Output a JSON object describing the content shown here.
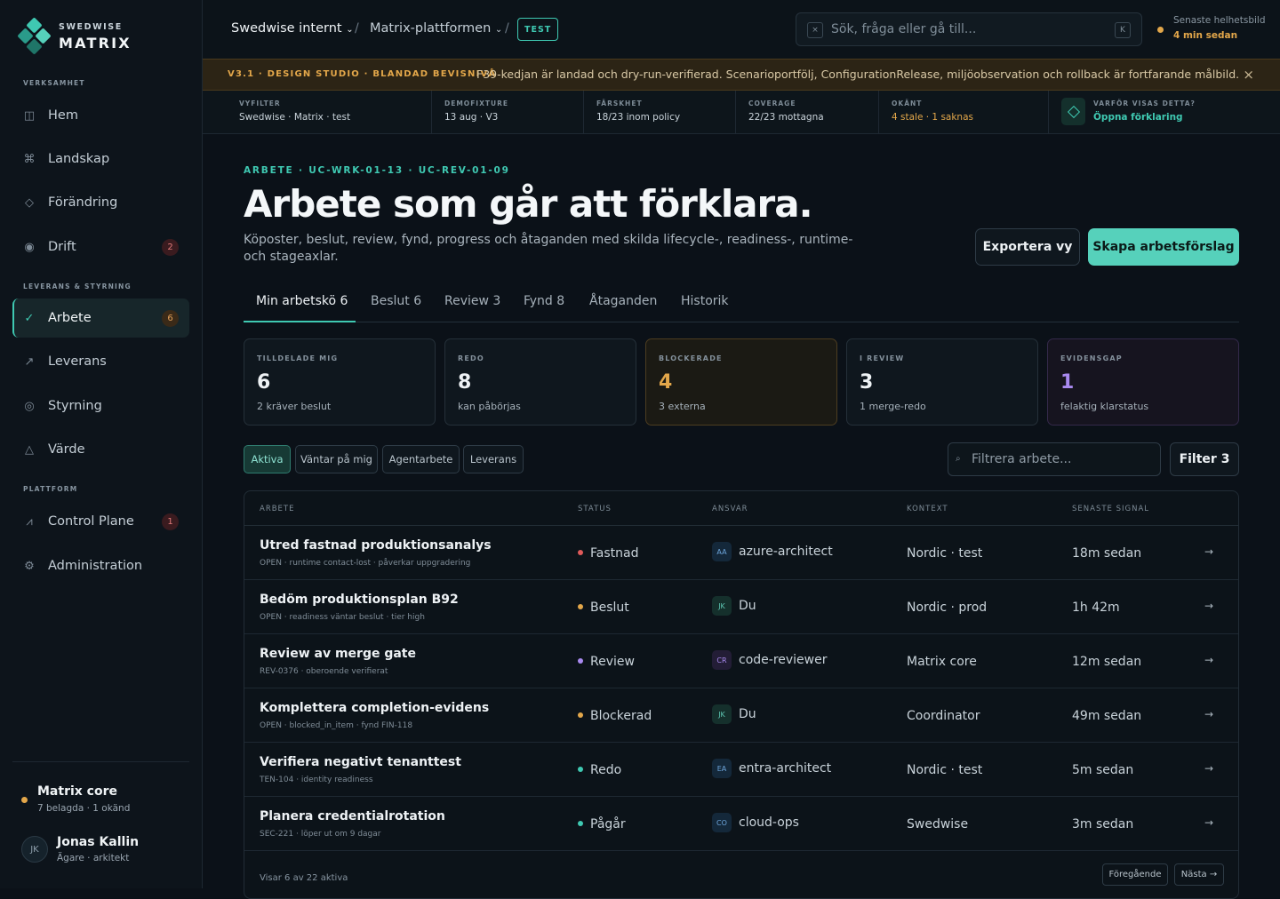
{
  "brand": {
    "top": "SWEDWISE",
    "main": "MATRIX",
    "colors": [
      "#3fc9b2",
      "#2a9b8a",
      "#56d1bb",
      "#1f7568"
    ]
  },
  "sidebar": {
    "sections": [
      "VERKSAMHET",
      "LEVERANS & STYRNING",
      "PLATTFORM"
    ],
    "items": [
      {
        "label": "Hem",
        "icon": "book-icon",
        "glyph": "◫"
      },
      {
        "label": "Landskap",
        "icon": "command-icon",
        "glyph": "⌘"
      },
      {
        "label": "Förändring",
        "icon": "diamond-icon",
        "glyph": "◇"
      },
      {
        "label": "Drift",
        "icon": "radio-icon",
        "glyph": "◉",
        "badge": "2"
      },
      {
        "label": "Arbete",
        "icon": "check-icon",
        "glyph": "✓",
        "badge": "6"
      },
      {
        "label": "Leverans",
        "icon": "arrow-up-right-icon",
        "glyph": "↗"
      },
      {
        "label": "Styrning",
        "icon": "circle-icon",
        "glyph": "◎"
      },
      {
        "label": "Värde",
        "icon": "triangle-icon",
        "glyph": "△"
      },
      {
        "label": "Control Plane",
        "icon": "activity-icon",
        "glyph": "⩘",
        "badge": "1"
      },
      {
        "label": "Administration",
        "icon": "gear-icon",
        "glyph": "⚙"
      }
    ],
    "workspace": {
      "name": "Matrix core",
      "sub": "7 belagda · 1 okänd"
    },
    "user": {
      "initials": "JK",
      "name": "Jonas Kallin",
      "role": "Ägare · arkitekt"
    }
  },
  "topbar": {
    "crumbs": [
      "Swedwise internt",
      "Matrix-plattformen"
    ],
    "env": "TEST",
    "search_placeholder": "Sök, fråga eller gå till...",
    "search_icon": "×",
    "search_kbd": "K",
    "latest_label": "Senaste helhetsbild",
    "latest_value": "4 min sedan"
  },
  "banner": {
    "tag": "V3.1 · DESIGN STUDIO · BLANDAD BEVISNIVÅ",
    "message": "F39-kedjan är landad och dry-run-verifierad. Scenarioportfölj, ConfigurationRelease, miljöobservation och rollback är fortfarande målbild.",
    "close": "×"
  },
  "meta": [
    {
      "key": "VYFILTER",
      "value": "Swedwise · Matrix · test"
    },
    {
      "key": "DEMOFIXTURE",
      "value": "13 aug · V3"
    },
    {
      "key": "FÄRSKHET",
      "value": "18/23 inom policy"
    },
    {
      "key": "COVERAGE",
      "value": "22/23 mottagna"
    },
    {
      "key": "OKÄNT",
      "value": "4 stale · 1 saknas"
    },
    {
      "key": "VARFÖR VISAS DETTA?",
      "value": "Öppna förklaring"
    }
  ],
  "page": {
    "eyebrow": "ARBETE · UC-WRK-01-13 · UC-REV-01-09",
    "title": "Arbete som går att förklara.",
    "description": "Köposter, beslut, review, fynd, progress och åtaganden med skilda lifecycle-, readiness-, runtime- och stageaxlar.",
    "export_label": "Exportera vy",
    "create_label": "Skapa arbetsförslag"
  },
  "tabs": [
    "Min arbetskö 6",
    "Beslut 6",
    "Review 3",
    "Fynd 8",
    "Åtaganden",
    "Historik"
  ],
  "cards": [
    {
      "key": "TILLDELADE MIG",
      "value": "6",
      "sub": "2 kräver beslut"
    },
    {
      "key": "REDO",
      "value": "8",
      "sub": "kan påbörjas"
    },
    {
      "key": "BLOCKERADE",
      "value": "4",
      "sub": "3 externa"
    },
    {
      "key": "I REVIEW",
      "value": "3",
      "sub": "1 merge-redo"
    },
    {
      "key": "EVIDENSGAP",
      "value": "1",
      "sub": "felaktig klarstatus"
    }
  ],
  "chips": [
    "Aktiva",
    "Väntar på mig",
    "Agentarbete",
    "Leverans"
  ],
  "filter": {
    "placeholder": "Filtrera arbete...",
    "icon": "⌕",
    "button": "Filter 3"
  },
  "table": {
    "headers": [
      "ARBETE",
      "STATUS",
      "ANSVAR",
      "KONTEXT",
      "SENASTE SIGNAL"
    ],
    "rows": [
      {
        "title": "Utred fastnad produktionsanalys",
        "sub": "OPEN · runtime contact-lost · påverkar uppgradering",
        "status": "Fastnad",
        "status_color": "#e05a5a",
        "initials": "AA",
        "owner": "azure-architect",
        "context": "Nordic · test",
        "signal": "18m sedan"
      },
      {
        "title": "Bedöm produktionsplan B92",
        "sub": "OPEN · readiness väntar beslut · tier high",
        "status": "Beslut",
        "status_color": "#e3a74a",
        "initials": "JK",
        "owner": "Du",
        "context": "Nordic · prod",
        "signal": "1h 42m"
      },
      {
        "title": "Review av merge gate",
        "sub": "REV-0376 · oberoende verifierat",
        "status": "Review",
        "status_color": "#a98af0",
        "initials": "CR",
        "owner": "code-reviewer",
        "context": "Matrix core",
        "signal": "12m sedan"
      },
      {
        "title": "Komplettera completion-evidens",
        "sub": "OPEN · blocked_in_item · fynd FIN-118",
        "status": "Blockerad",
        "status_color": "#e3a74a",
        "initials": "JK",
        "owner": "Du",
        "context": "Coordinator",
        "signal": "49m sedan"
      },
      {
        "title": "Verifiera negativt tenanttest",
        "sub": "TEN-104 · identity readiness",
        "status": "Redo",
        "status_color": "#3fc9b2",
        "initials": "EA",
        "owner": "entra-architect",
        "context": "Nordic · test",
        "signal": "5m sedan"
      },
      {
        "title": "Planera credentialrotation",
        "sub": "SEC-221 · löper ut om 9 dagar",
        "status": "Pågår",
        "status_color": "#3fc9b2",
        "initials": "CO",
        "owner": "cloud-ops",
        "context": "Swedwise",
        "signal": "3m sedan"
      }
    ],
    "footer": "Visar 6 av 22 aktiva",
    "prev": "Föregående",
    "next": "Nästa →",
    "row_arrow": "→"
  }
}
